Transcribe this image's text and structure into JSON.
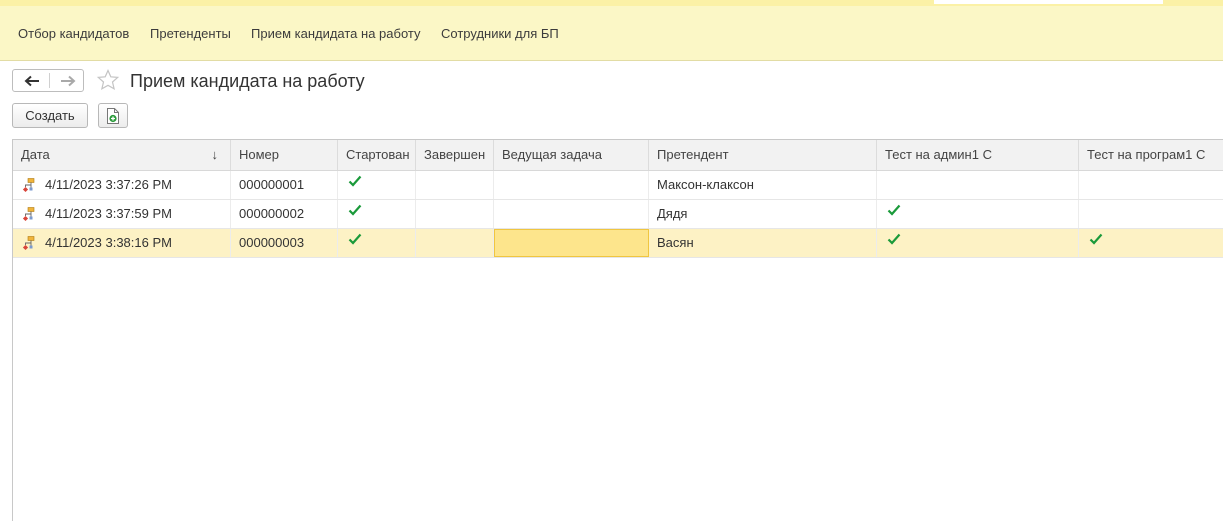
{
  "nav": {
    "items": [
      "Отбор кандидатов",
      "Претенденты",
      "Прием кандидата на работу",
      "Сотрудники для БП"
    ]
  },
  "header": {
    "title": "Прием кандидата на работу",
    "back_icon": "arrow-left-icon",
    "forward_icon": "arrow-right-icon",
    "favorite_icon": "star-outline-icon"
  },
  "toolbar": {
    "create_label": "Создать",
    "doc_icon": "add-document-icon"
  },
  "table": {
    "columns": [
      "Дата",
      "Номер",
      "Стартован",
      "Завершен",
      "Ведущая задача",
      "Претендент",
      "Тест на админ1 С",
      "Тест на програм1 С"
    ],
    "sort_indicator": "↓",
    "rows": [
      {
        "date": "4/11/2023 3:37:26 PM",
        "number": "000000001",
        "started": true,
        "finished": false,
        "lead_task": "",
        "candidate": "Максон-клаксон",
        "test_admin": false,
        "test_prog": false,
        "selected": false
      },
      {
        "date": "4/11/2023 3:37:59 PM",
        "number": "000000002",
        "started": true,
        "finished": false,
        "lead_task": "",
        "candidate": "Дядя",
        "test_admin": true,
        "test_prog": false,
        "selected": false
      },
      {
        "date": "4/11/2023 3:38:16 PM",
        "number": "000000003",
        "started": true,
        "finished": false,
        "lead_task": "",
        "candidate": "Васян",
        "test_admin": true,
        "test_prog": true,
        "selected": true
      }
    ]
  },
  "colors": {
    "nav_bg": "#fbf7c6",
    "check": "#1a9a3a",
    "selected_row": "#fdf2c5",
    "focused_cell": "#fde58c"
  }
}
